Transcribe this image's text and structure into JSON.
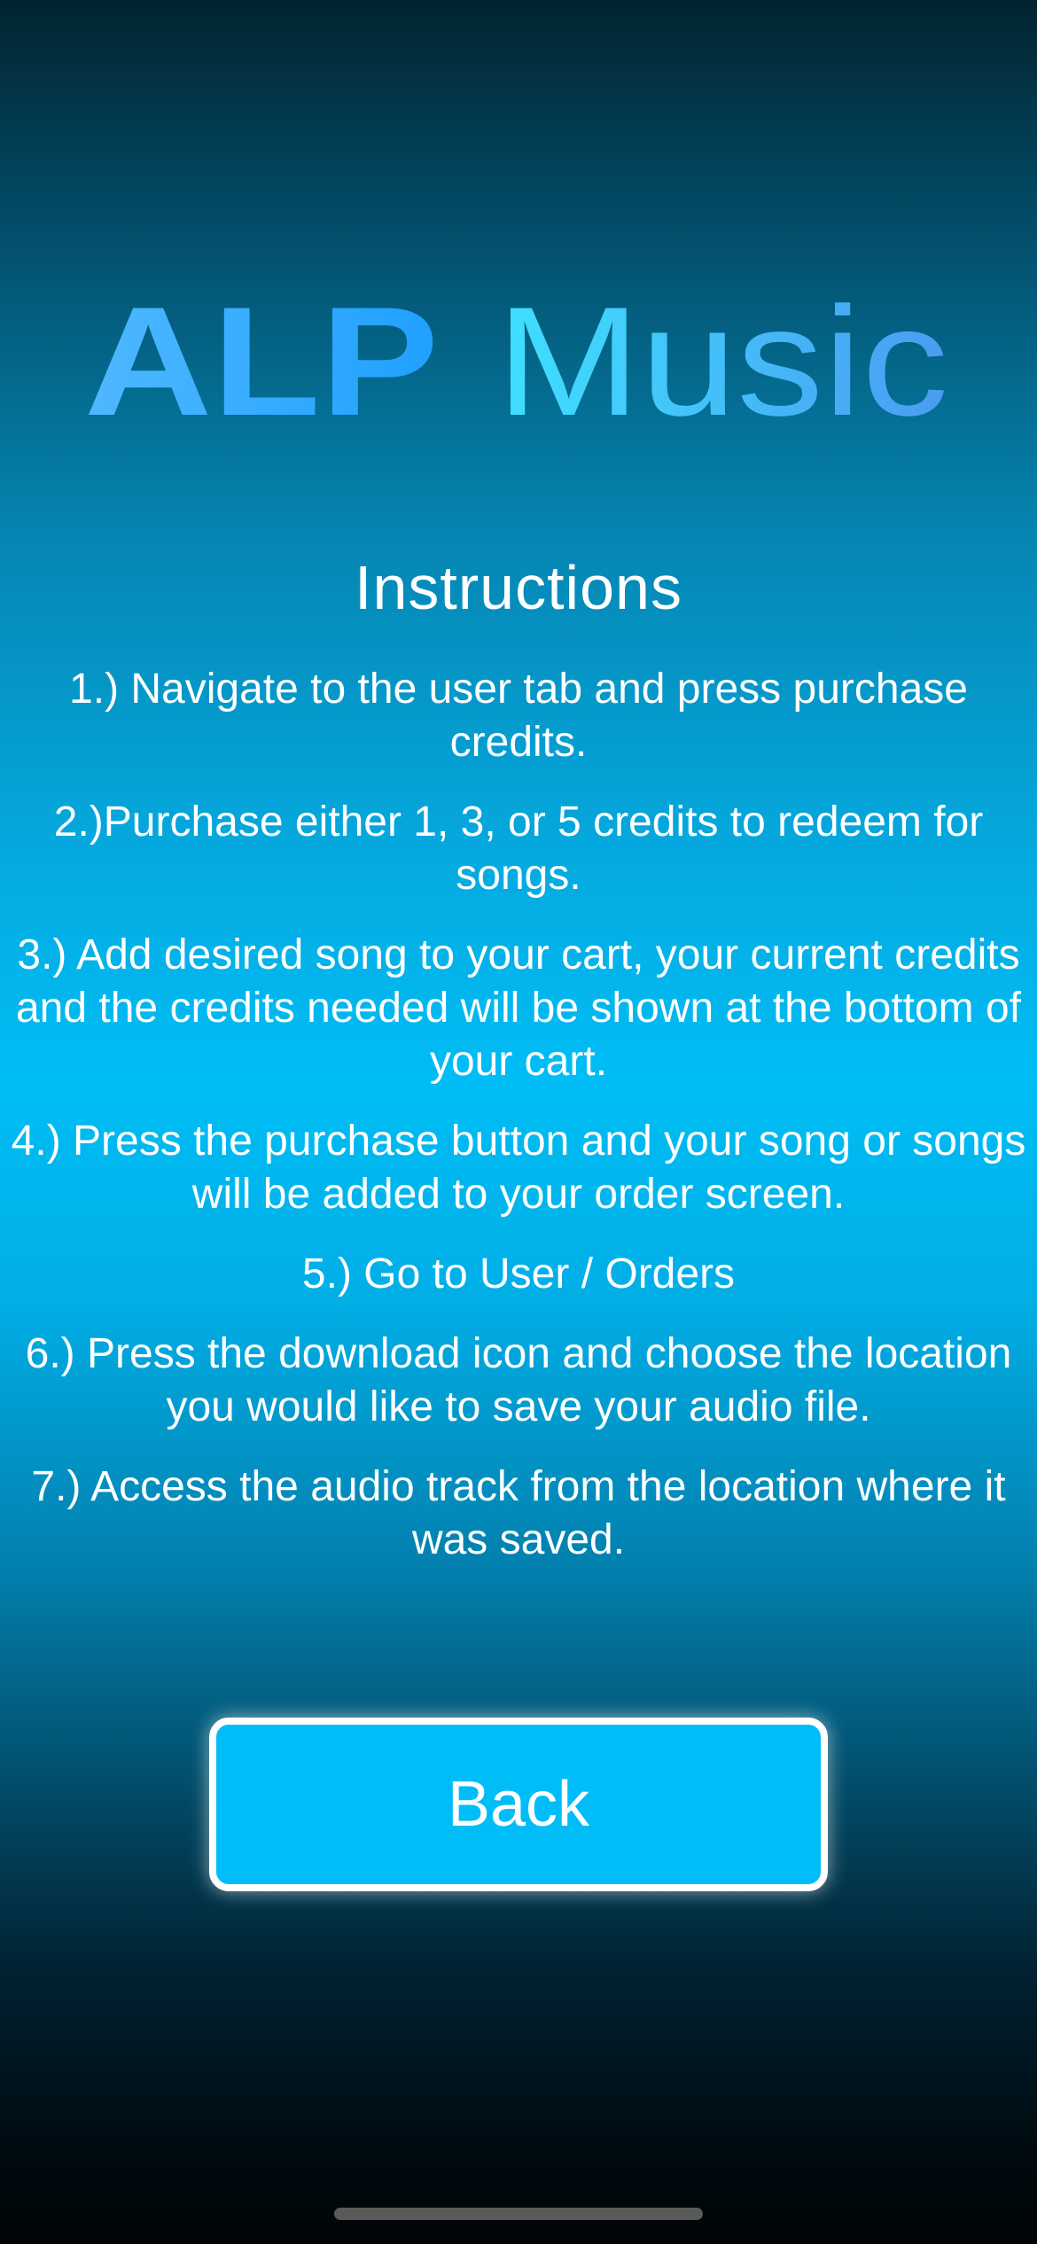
{
  "logo": {
    "text_bold": "ALP",
    "text_light": "Music",
    "colors": {
      "bold_start": "#4fb8ff",
      "bold_end": "#1fa0ff",
      "light_start": "#3fe0ff",
      "light_end": "#4a9cf2"
    }
  },
  "title": "Instructions",
  "instructions": [
    "1.) Navigate to the user tab and press purchase credits.",
    "2.)Purchase either 1, 3, or 5 credits to redeem for songs.",
    "3.) Add desired song to your cart, your current credits and the credits needed will be shown at the bottom of your cart.",
    "4.) Press the purchase button and your song or songs will be added to your order screen.",
    "5.) Go to User / Orders",
    "6.) Press the download icon and choose the location you would like to save your audio file.",
    "7.) Access the audio track from the location where it was saved."
  ],
  "back_button": {
    "label": "Back",
    "color": "#00bdf8"
  }
}
